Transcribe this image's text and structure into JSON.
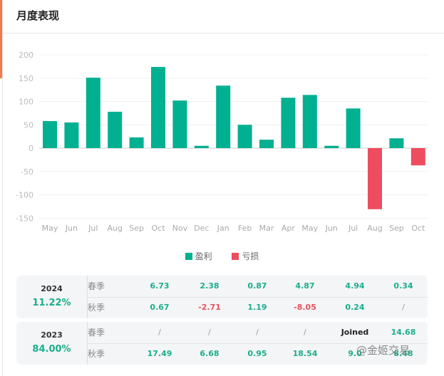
{
  "title": "月度表现",
  "chart_data": {
    "type": "bar",
    "categories": [
      "May",
      "Jun",
      "Jul",
      "Aug",
      "Sep",
      "Oct",
      "Nov",
      "Dec",
      "Jan",
      "Feb",
      "Mar",
      "Apr",
      "May",
      "Jun",
      "Jul",
      "Aug",
      "Sep",
      "Oct"
    ],
    "values": [
      58,
      55,
      151,
      78,
      23,
      174,
      102,
      5,
      134,
      50,
      18,
      108,
      114,
      5,
      85,
      -131,
      21,
      -37
    ],
    "yticks": [
      200,
      150,
      100,
      50,
      0,
      -50,
      -100,
      -150
    ],
    "ylim": [
      -150,
      200
    ],
    "grid": true,
    "legend": {
      "position": "bottom",
      "entries": [
        "盈利",
        "亏损"
      ]
    },
    "colors": {
      "profit": "#00b090",
      "loss": "#ee4d5f"
    }
  },
  "table": [
    {
      "year": "2024",
      "percent": "11.22%",
      "rows": [
        {
          "label": "春季",
          "values": [
            "6.73",
            "2.38",
            "0.87",
            "4.87",
            "4.94",
            "0.34"
          ]
        },
        {
          "label": "秋季",
          "values": [
            "0.67",
            "-2.71",
            "1.19",
            "-8.05",
            "0.24",
            "/"
          ]
        }
      ]
    },
    {
      "year": "2023",
      "percent": "84.00%",
      "rows": [
        {
          "label": "春季",
          "values": [
            "/",
            "/",
            "/",
            "/",
            "Joined",
            "14.68"
          ]
        },
        {
          "label": "秋季",
          "values": [
            "17.49",
            "6.68",
            "0.95",
            "18.54",
            "9.0",
            "8.48"
          ]
        }
      ]
    }
  ],
  "watermark": "@金姬交易"
}
